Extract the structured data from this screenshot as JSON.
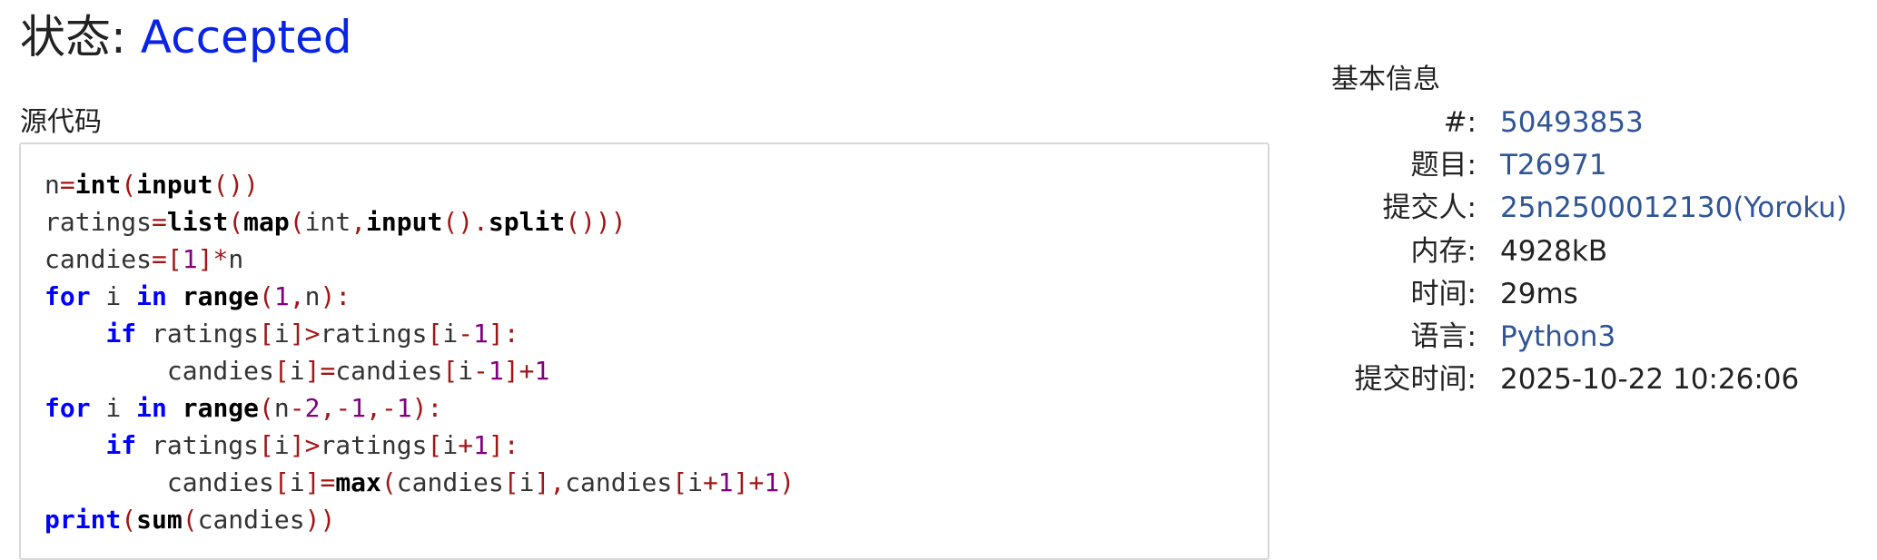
{
  "status": {
    "label": "状态: ",
    "value": "Accepted"
  },
  "source": {
    "label": "源代码",
    "lines": [
      [
        {
          "t": "n",
          "c": "id"
        },
        {
          "t": "=",
          "c": "op"
        },
        {
          "t": "int",
          "c": "fn"
        },
        {
          "t": "(",
          "c": "op"
        },
        {
          "t": "input",
          "c": "fn"
        },
        {
          "t": "())",
          "c": "op"
        }
      ],
      [
        {
          "t": "ratings",
          "c": "id"
        },
        {
          "t": "=",
          "c": "op"
        },
        {
          "t": "list",
          "c": "fn"
        },
        {
          "t": "(",
          "c": "op"
        },
        {
          "t": "map",
          "c": "fn"
        },
        {
          "t": "(",
          "c": "op"
        },
        {
          "t": "int",
          "c": "id"
        },
        {
          "t": ",",
          "c": "op"
        },
        {
          "t": "input",
          "c": "fn"
        },
        {
          "t": "().",
          "c": "op"
        },
        {
          "t": "split",
          "c": "fn"
        },
        {
          "t": "()))",
          "c": "op"
        }
      ],
      [
        {
          "t": "candies",
          "c": "id"
        },
        {
          "t": "=[",
          "c": "op"
        },
        {
          "t": "1",
          "c": "num"
        },
        {
          "t": "]*",
          "c": "op"
        },
        {
          "t": "n",
          "c": "id"
        }
      ],
      [
        {
          "t": "for",
          "c": "kw"
        },
        {
          "t": " i ",
          "c": "id"
        },
        {
          "t": "in",
          "c": "kw"
        },
        {
          "t": " ",
          "c": "id"
        },
        {
          "t": "range",
          "c": "fn"
        },
        {
          "t": "(",
          "c": "op"
        },
        {
          "t": "1",
          "c": "num"
        },
        {
          "t": ",",
          "c": "op"
        },
        {
          "t": "n",
          "c": "id"
        },
        {
          "t": "):",
          "c": "op"
        }
      ],
      [
        {
          "t": "    ",
          "c": "id"
        },
        {
          "t": "if",
          "c": "kw"
        },
        {
          "t": " ratings",
          "c": "id"
        },
        {
          "t": "[",
          "c": "op"
        },
        {
          "t": "i",
          "c": "id"
        },
        {
          "t": "]>",
          "c": "op"
        },
        {
          "t": "ratings",
          "c": "id"
        },
        {
          "t": "[",
          "c": "op"
        },
        {
          "t": "i",
          "c": "id"
        },
        {
          "t": "-",
          "c": "op"
        },
        {
          "t": "1",
          "c": "num"
        },
        {
          "t": "]:",
          "c": "op"
        }
      ],
      [
        {
          "t": "        candies",
          "c": "id"
        },
        {
          "t": "[",
          "c": "op"
        },
        {
          "t": "i",
          "c": "id"
        },
        {
          "t": "]=",
          "c": "op"
        },
        {
          "t": "candies",
          "c": "id"
        },
        {
          "t": "[",
          "c": "op"
        },
        {
          "t": "i",
          "c": "id"
        },
        {
          "t": "-",
          "c": "op"
        },
        {
          "t": "1",
          "c": "num"
        },
        {
          "t": "]+",
          "c": "op"
        },
        {
          "t": "1",
          "c": "num"
        }
      ],
      [
        {
          "t": "for",
          "c": "kw"
        },
        {
          "t": " i ",
          "c": "id"
        },
        {
          "t": "in",
          "c": "kw"
        },
        {
          "t": " ",
          "c": "id"
        },
        {
          "t": "range",
          "c": "fn"
        },
        {
          "t": "(",
          "c": "op"
        },
        {
          "t": "n",
          "c": "id"
        },
        {
          "t": "-",
          "c": "op"
        },
        {
          "t": "2",
          "c": "num"
        },
        {
          "t": ",-",
          "c": "op"
        },
        {
          "t": "1",
          "c": "num"
        },
        {
          "t": ",-",
          "c": "op"
        },
        {
          "t": "1",
          "c": "num"
        },
        {
          "t": "):",
          "c": "op"
        }
      ],
      [
        {
          "t": "    ",
          "c": "id"
        },
        {
          "t": "if",
          "c": "kw"
        },
        {
          "t": " ratings",
          "c": "id"
        },
        {
          "t": "[",
          "c": "op"
        },
        {
          "t": "i",
          "c": "id"
        },
        {
          "t": "]>",
          "c": "op"
        },
        {
          "t": "ratings",
          "c": "id"
        },
        {
          "t": "[",
          "c": "op"
        },
        {
          "t": "i",
          "c": "id"
        },
        {
          "t": "+",
          "c": "op"
        },
        {
          "t": "1",
          "c": "num"
        },
        {
          "t": "]:",
          "c": "op"
        }
      ],
      [
        {
          "t": "        candies",
          "c": "id"
        },
        {
          "t": "[",
          "c": "op"
        },
        {
          "t": "i",
          "c": "id"
        },
        {
          "t": "]=",
          "c": "op"
        },
        {
          "t": "max",
          "c": "fn"
        },
        {
          "t": "(",
          "c": "op"
        },
        {
          "t": "candies",
          "c": "id"
        },
        {
          "t": "[",
          "c": "op"
        },
        {
          "t": "i",
          "c": "id"
        },
        {
          "t": "],",
          "c": "op"
        },
        {
          "t": "candies",
          "c": "id"
        },
        {
          "t": "[",
          "c": "op"
        },
        {
          "t": "i",
          "c": "id"
        },
        {
          "t": "+",
          "c": "op"
        },
        {
          "t": "1",
          "c": "num"
        },
        {
          "t": "]+",
          "c": "op"
        },
        {
          "t": "1",
          "c": "num"
        },
        {
          "t": ")",
          "c": "op"
        }
      ],
      [
        {
          "t": "print",
          "c": "kw"
        },
        {
          "t": "(",
          "c": "op"
        },
        {
          "t": "sum",
          "c": "fn"
        },
        {
          "t": "(",
          "c": "op"
        },
        {
          "t": "candies",
          "c": "id"
        },
        {
          "t": "))",
          "c": "op"
        }
      ]
    ]
  },
  "info": {
    "label": "基本信息",
    "rows": [
      {
        "key": "#:",
        "value": "50493853",
        "link": true
      },
      {
        "key": "题目:",
        "value": "T26971",
        "link": true
      },
      {
        "key": "提交人:",
        "value": "25n2500012130(Yoroku)",
        "link": true
      },
      {
        "key": "内存:",
        "value": "4928kB",
        "link": false
      },
      {
        "key": "时间:",
        "value": "29ms",
        "link": false
      },
      {
        "key": "语言:",
        "value": "Python3",
        "link": true
      },
      {
        "key": "提交时间:",
        "value": "2025-10-22 10:26:06",
        "link": false
      }
    ]
  },
  "colors": {
    "accepted": "#0a24e6",
    "link": "#2f5597",
    "keyword": "#0000ff",
    "operator": "#a31515",
    "number": "#800080"
  }
}
